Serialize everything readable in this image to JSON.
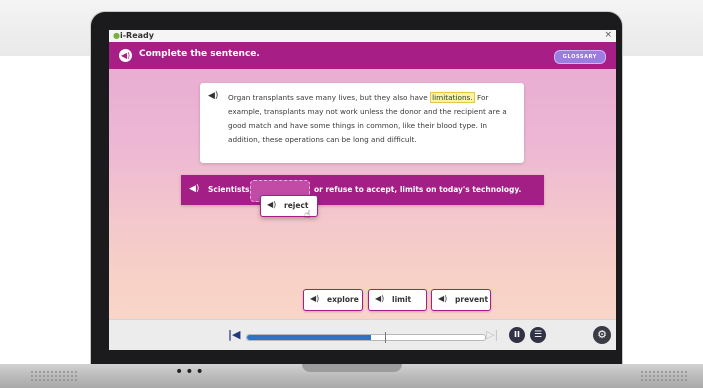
{
  "window": {
    "app_name": "i-Ready",
    "close_glyph": "×"
  },
  "header": {
    "title": "Complete the sentence.",
    "glossary_label": "GLOSSARY",
    "speaker_icon": "speaker-icon"
  },
  "passage": {
    "text_before": "Organ transplants save many lives, but they also have ",
    "highlight": "limitations.",
    "text_after": " For example, transplants may not work unless the donor and the recipient are a good match and have some things in common, like their blood type. In addition, these operations can be long and difficult."
  },
  "sentence": {
    "part1": "Scientists",
    "part2": "or refuse to accept, limits on today's technology."
  },
  "dragged_choice": "reject",
  "word_bank": [
    "explore",
    "limit",
    "prevent"
  ],
  "player": {
    "progress_percent": 52,
    "pause_glyph": "II",
    "menu_glyph": "☰",
    "settings_glyph": "⚙"
  },
  "colors": {
    "primary_magenta": "#a81e87",
    "progress_blue": "#2e73c6",
    "glossary_purple": "#9b7ce0"
  },
  "laptop": {
    "base_dots": "•••"
  }
}
